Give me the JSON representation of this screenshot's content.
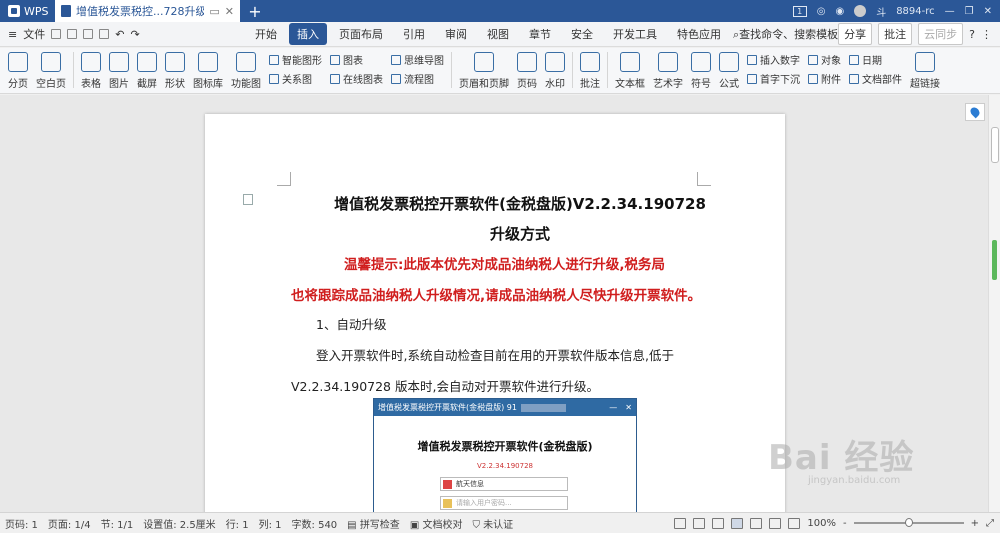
{
  "titlebar": {
    "app_label": "WPS",
    "doc_tab": "增值税发票税控...728升级方式",
    "new_tab": "+",
    "page_count_badge": "1",
    "user": "斗",
    "user_id": "8894-rc"
  },
  "menubar": {
    "file_label": "文件",
    "tabs": [
      "开始",
      "插入",
      "页面布局",
      "引用",
      "审阅",
      "视图",
      "章节",
      "安全",
      "开发工具",
      "特色应用"
    ],
    "active_tab": "插入",
    "search_cmd": "查找命令、搜索模板",
    "share": "分享",
    "comment": "批注",
    "sync": "云同步",
    "help": "?"
  },
  "ribbon": {
    "page_break": "分页",
    "blank_page": "空白页",
    "table": "表格",
    "picture": "图片",
    "screenshot": "截屏",
    "shape": "形状",
    "icon_lib": "图标库",
    "func_chart": "功能图",
    "smart_graphic": "智能图形",
    "chart": "图表",
    "mindmap": "思维导图",
    "relation": "关系图",
    "online_chart": "在线图表",
    "flowchart": "流程图",
    "header_footer": "页眉和页脚",
    "page_num": "页码",
    "watermark": "水印",
    "comment": "批注",
    "textbox": "文本框",
    "wordart": "艺术字",
    "symbol": "符号",
    "formula": "公式",
    "insert_number": "插入数字",
    "object": "对象",
    "date": "日期",
    "drop_cap": "首字下沉",
    "attachment": "附件",
    "doc_parts": "文档部件",
    "hyperlink": "超链接"
  },
  "document": {
    "title_line1": "增值税发票税控开票软件(金税盘版)V2.2.34.190728",
    "title_line2": "升级方式",
    "notice_line1": "温馨提示:此版本优先对成品油纳税人进行升级,税务局",
    "notice_line2": "也将跟踪成品油纳税人升级情况,请成品油纳税人尽快升级开票软件。",
    "section1": "1、自动升级",
    "para1_line1": "登入开票软件时,系统自动检查目前在用的开票软件版本信息,低于",
    "para1_line2": "V2.2.34.190728 版本时,会自动对开票软件进行升级。"
  },
  "embedded_screenshot": {
    "window_title": "增值税发票税控开票软件(金税盘版) 91",
    "app_title": "增值税发票税控开票软件(金税盘版)",
    "version": "V2.2.34.190728",
    "user_field": "航天信息",
    "password_placeholder": "请输入用户密码..."
  },
  "statusbar": {
    "page_num": "页码: 1",
    "pages": "页面: 1/4",
    "section": "节: 1/1",
    "setting": "设置值: 2.5厘米",
    "row": "行: 1",
    "col": "列: 1",
    "words": "字数: 540",
    "spell": "拼写检查",
    "proof": "文档校对",
    "auth": "未认证",
    "zoom": "100%",
    "zoom_minus": "-",
    "zoom_plus": "+",
    "zoom_level": 0.5
  },
  "watermark": {
    "main": "Bai 经验",
    "sub": "jingyan.baidu.com"
  }
}
